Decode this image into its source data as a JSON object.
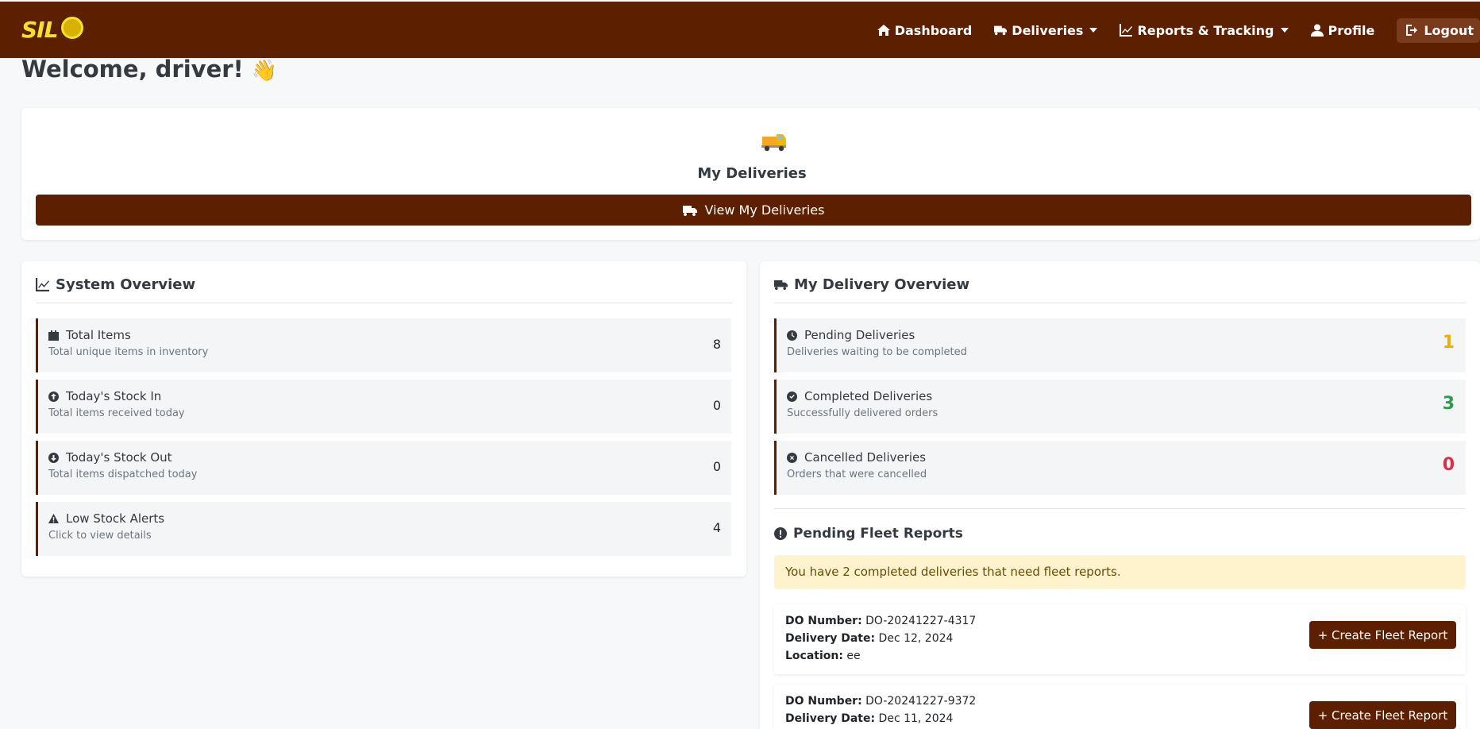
{
  "nav": {
    "brand": "SIL",
    "items": [
      {
        "label": "Dashboard",
        "icon": "home-icon"
      },
      {
        "label": "Deliveries",
        "icon": "truck-icon"
      },
      {
        "label": "Reports & Tracking",
        "icon": "chart-icon"
      },
      {
        "label": "Profile",
        "icon": "user-icon"
      },
      {
        "label": "Logout",
        "icon": "logout-icon"
      }
    ]
  },
  "welcome": {
    "text": "Welcome, driver!",
    "emoji": "👋"
  },
  "my_deliveries": {
    "title": "My Deliveries",
    "button": "View My Deliveries"
  },
  "system_overview": {
    "title": "System Overview",
    "stats": [
      {
        "name": "Total Items",
        "desc": "Total unique items in inventory",
        "value": "8",
        "icon": "calendar-icon"
      },
      {
        "name": "Today's Stock In",
        "desc": "Total items received today",
        "value": "0",
        "icon": "arrow-up-circle-icon"
      },
      {
        "name": "Today's Stock Out",
        "desc": "Total items dispatched today",
        "value": "0",
        "icon": "arrow-down-circle-icon"
      },
      {
        "name": "Low Stock Alerts",
        "desc": "Click to view details",
        "value": "4",
        "icon": "warning-icon"
      }
    ]
  },
  "delivery_overview": {
    "title": "My Delivery Overview",
    "stats": [
      {
        "name": "Pending Deliveries",
        "desc": "Deliveries waiting to be completed",
        "value": "1",
        "icon": "clock-icon",
        "color": "#f0ad00"
      },
      {
        "name": "Completed Deliveries",
        "desc": "Successfully delivered orders",
        "value": "3",
        "icon": "check-circle-icon",
        "color": "#2e9b48"
      },
      {
        "name": "Cancelled Deliveries",
        "desc": "Orders that were cancelled",
        "value": "0",
        "icon": "x-circle-icon",
        "color": "#dc2f45"
      }
    ]
  },
  "fleet": {
    "title": "Pending Fleet Reports",
    "alert": "You have 2 completed deliveries that need fleet reports.",
    "labels": {
      "do": "DO Number:",
      "date": "Delivery Date:",
      "location": "Location:"
    },
    "button": "+ Create Fleet Report",
    "reports": [
      {
        "do": "DO-20241227-4317",
        "date": "Dec 12, 2024",
        "location": "ee"
      },
      {
        "do": "DO-20241227-9372",
        "date": "Dec 11, 2024",
        "location": ""
      }
    ]
  },
  "colors": {
    "brand": "#5c1f00",
    "logo": "#f5e02a",
    "alert_bg": "#fff3cd"
  }
}
